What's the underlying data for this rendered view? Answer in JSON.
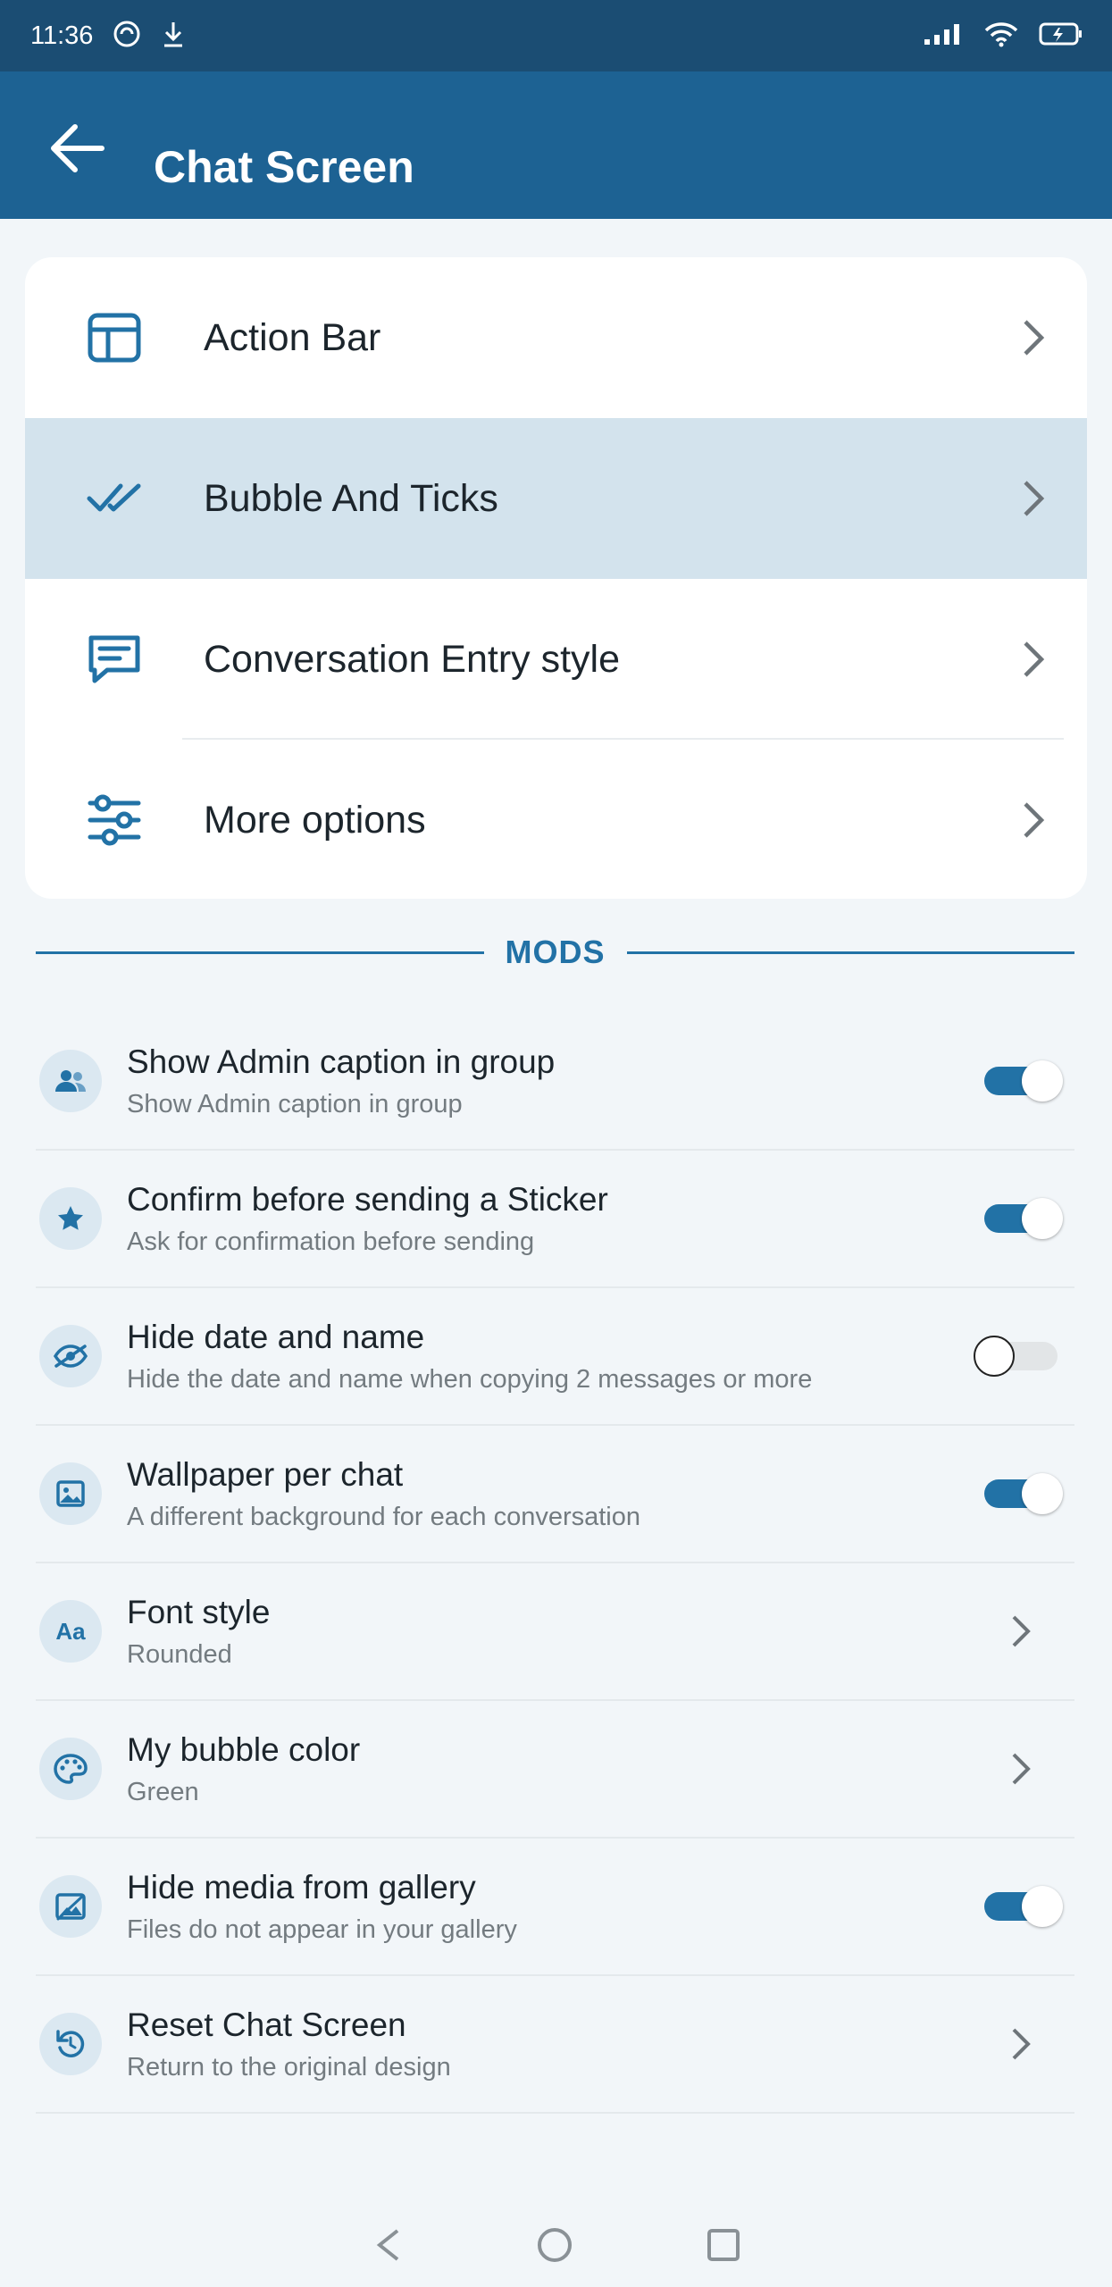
{
  "status_bar": {
    "time": "11:36"
  },
  "app_bar": {
    "title": "Chat Screen"
  },
  "menu": [
    {
      "label": "Action Bar",
      "icon": "layout-icon"
    },
    {
      "label": "Bubble And Ticks",
      "icon": "double-check-icon",
      "active": true
    },
    {
      "label": "Conversation Entry style",
      "icon": "chat-bubble-icon"
    },
    {
      "label": "More options",
      "icon": "sliders-icon"
    }
  ],
  "mods_header": "MODS",
  "mods": [
    {
      "title": "Show Admin caption in group",
      "subtitle": "Show Admin caption in group",
      "icon": "group-icon",
      "toggle": true
    },
    {
      "title": "Confirm before sending a Sticker",
      "subtitle": "Ask for confirmation before sending",
      "icon": "star-icon",
      "toggle": true
    },
    {
      "title": "Hide date and name",
      "subtitle": "Hide the date and name when copying 2 messages or more",
      "icon": "eye-off-icon",
      "toggle": false
    },
    {
      "title": "Wallpaper per chat",
      "subtitle": "A different background for each conversation",
      "icon": "image-icon",
      "toggle": true
    },
    {
      "title": "Font style",
      "subtitle": "Rounded",
      "icon": "font-icon",
      "icon_text": "Aa"
    },
    {
      "title": "My bubble color",
      "subtitle": "Green",
      "icon": "palette-icon"
    },
    {
      "title": "Hide media from gallery",
      "subtitle": "Files do not appear in your gallery",
      "icon": "gallery-off-icon",
      "toggle": true
    },
    {
      "title": "Reset Chat Screen",
      "subtitle": "Return to the original design",
      "icon": "reset-icon"
    }
  ],
  "colors": {
    "status_bar": "#1b4d73",
    "app_bar": "#1d6293",
    "accent": "#2272a6",
    "active_row": "#d3e3ed",
    "background": "#f2f6f9"
  }
}
